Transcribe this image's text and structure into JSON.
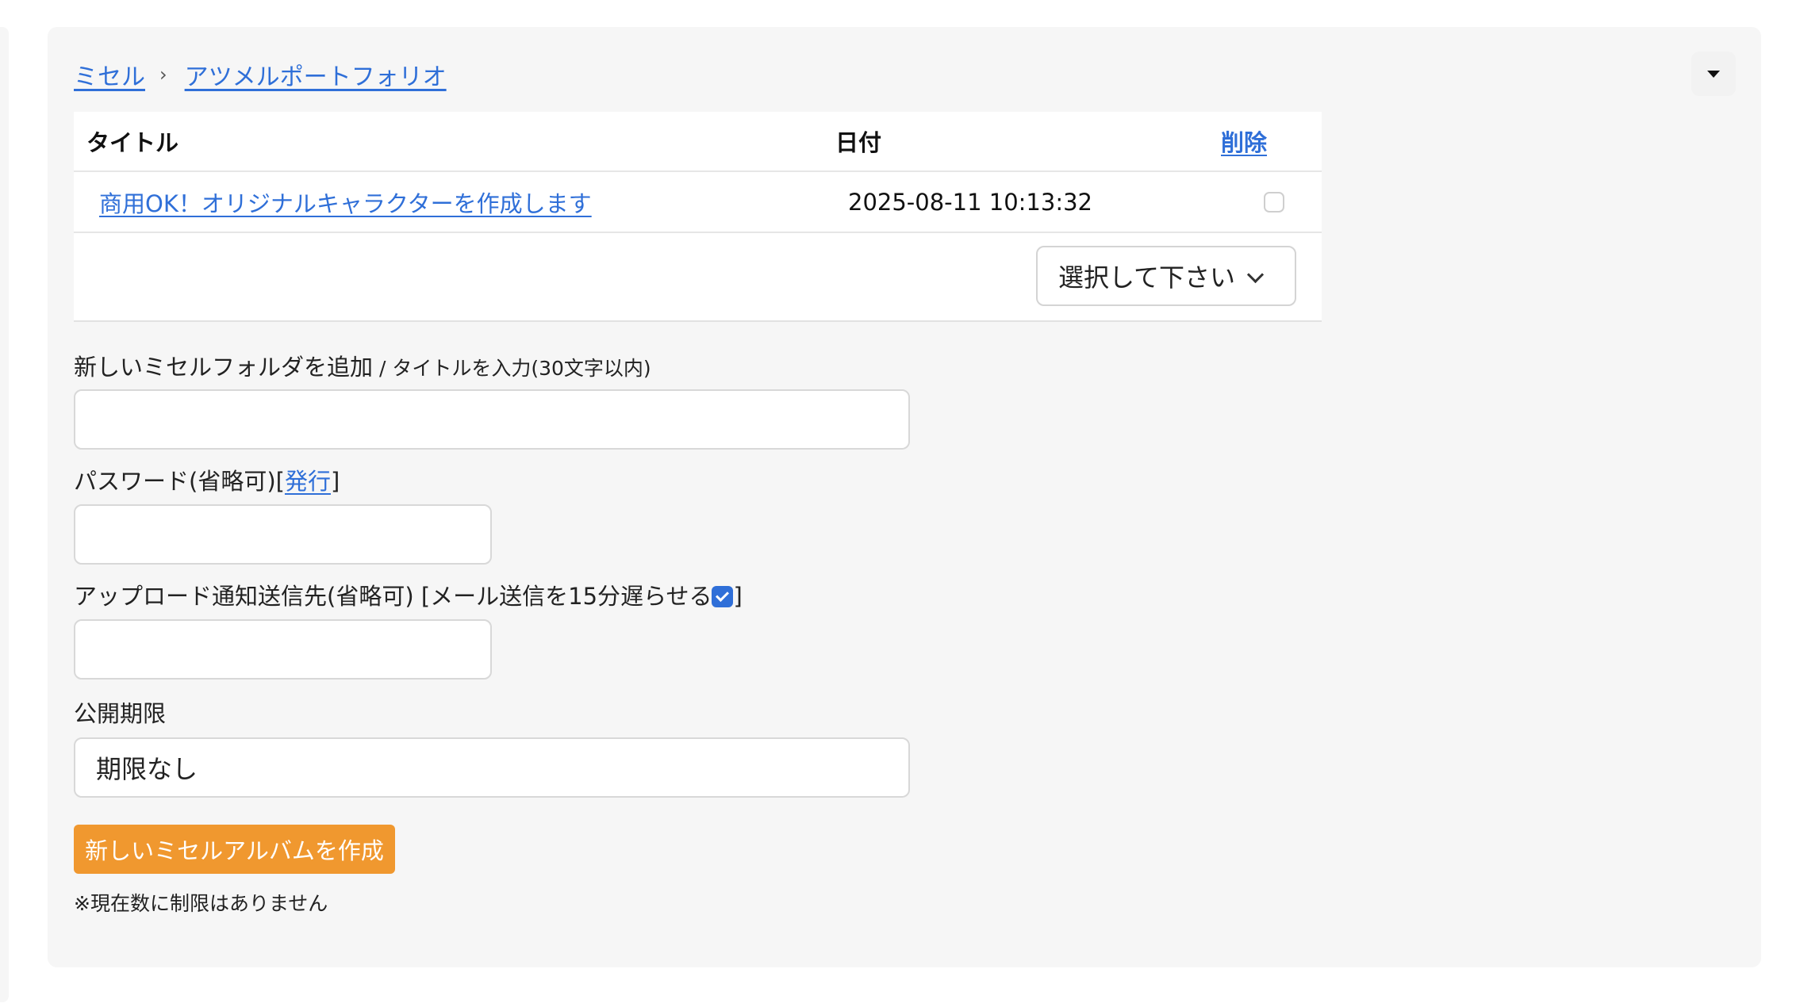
{
  "breadcrumb": {
    "home": "ミセル",
    "separator": "›",
    "current": "アツメルポートフォリオ"
  },
  "table": {
    "headers": {
      "title": "タイトル",
      "date": "日付",
      "delete": "削除"
    },
    "rows": [
      {
        "title": "商用OK！オリジナルキャラクターを作成します",
        "date": "2025-08-11 10:13:32",
        "checked": false
      }
    ],
    "action_select": "選択して下さい"
  },
  "form": {
    "folder_label": "新しいミセルフォルダを追加",
    "folder_label_hint": " / タイトルを入力(30文字以内)",
    "folder_value": "",
    "password_label": "パスワード(省略可)[",
    "password_issue_link": "発行",
    "password_label_end": "]",
    "password_value": "",
    "notify_label": "アップロード通知送信先(省略可) [メール送信を15分遅らせる",
    "notify_label_end": "]",
    "notify_delay_checked": true,
    "notify_value": "",
    "expiry_label": "公開期限",
    "expiry_value": "期限なし",
    "create_button": "新しいミセルアルバムを作成",
    "note": "※現在数に制限はありません"
  },
  "colors": {
    "link": "#2f6fd8",
    "button": "#f0982f",
    "panel": "#f6f6f6"
  },
  "icons": {
    "toggle": "caret-down-icon",
    "breadcrumb_sep": "chevron-right-icon",
    "select": "chevron-down-icon"
  }
}
